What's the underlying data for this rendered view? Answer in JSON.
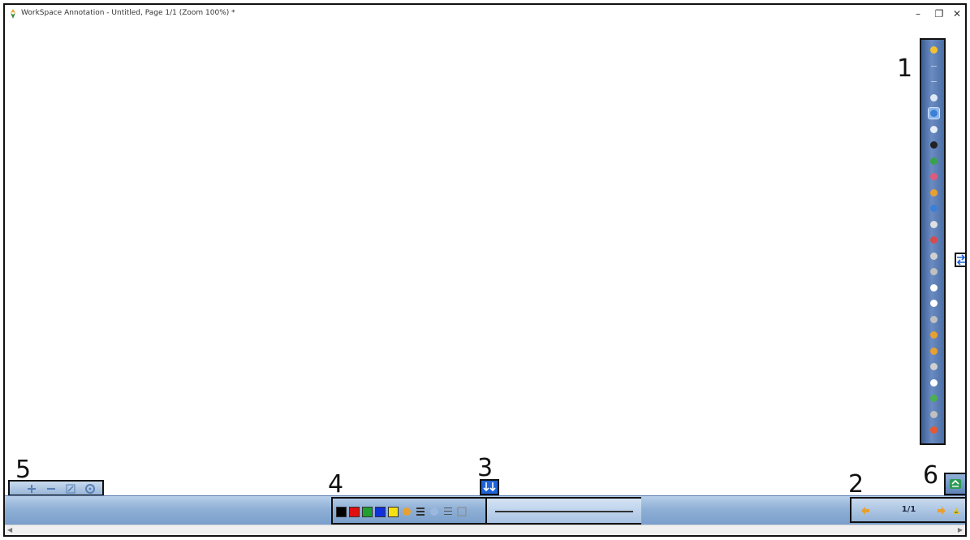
{
  "window": {
    "title": "WorkSpace Annotation - Untitled, Page 1/1  (Zoom 100%) *",
    "minimize": "–",
    "restore": "❐",
    "close": "✕"
  },
  "callouts": {
    "vertical_toolbar": "1",
    "page_navigation": "2",
    "expand_toggle": "3",
    "pen_settings": "4",
    "zoom_toolbar": "5",
    "desktop_mode": "6"
  },
  "vertical_toolbar": {
    "tools": [
      {
        "name": "workspace-logo-icon",
        "color": "#f2c230"
      },
      {
        "name": "toolbar-grip-icon",
        "color": "#b8c9e3"
      },
      {
        "name": "toolbar-grip-icon",
        "color": "#b8c9e3"
      },
      {
        "name": "hand-pan-icon",
        "color": "#dfe8f5"
      },
      {
        "name": "zoom-select-icon",
        "color": "#3b7fd8",
        "selected": true
      },
      {
        "name": "select-pointer-icon",
        "color": "#e8eef7"
      },
      {
        "name": "pen-icon",
        "color": "#222222"
      },
      {
        "name": "highlighter-icon",
        "color": "#3aa34a"
      },
      {
        "name": "eraser-icon",
        "color": "#e05a7a"
      },
      {
        "name": "area-eraser-icon",
        "color": "#e8a030"
      },
      {
        "name": "shape-icon",
        "color": "#3b7fd8"
      },
      {
        "name": "text-icon",
        "color": "#e0e0e0"
      },
      {
        "name": "insert-image-icon",
        "color": "#d84b4b"
      },
      {
        "name": "stamp-icon",
        "color": "#d0d0d0"
      },
      {
        "name": "clear-page-icon",
        "color": "#c0c0c0"
      },
      {
        "name": "new-page-icon",
        "color": "#ffffff"
      },
      {
        "name": "duplicate-page-icon",
        "color": "#ffffff"
      },
      {
        "name": "screen-capture-icon",
        "color": "#c0c0c0"
      },
      {
        "name": "undo-icon",
        "color": "#e8a030"
      },
      {
        "name": "redo-icon",
        "color": "#e8a030"
      },
      {
        "name": "save-icon",
        "color": "#d0d0d0"
      },
      {
        "name": "print-icon",
        "color": "#ffffff"
      },
      {
        "name": "resources-icon",
        "color": "#4caf50"
      },
      {
        "name": "link-icon",
        "color": "#c0c0c0"
      },
      {
        "name": "exit-icon",
        "color": "#e8572f"
      }
    ]
  },
  "pen_settings": {
    "colors": [
      "#000000",
      "#e01010",
      "#20a030",
      "#1030d8",
      "#f5e010"
    ],
    "icons": [
      "custom-color-icon",
      "line-width-icon",
      "transparency-icon",
      "line-style-icon",
      "fill-icon"
    ]
  },
  "page_nav": {
    "indicator": "1/1",
    "prev_icon": "previous-page-icon",
    "next_icon": "next-page-icon",
    "add_icon": "add-page-icon"
  }
}
